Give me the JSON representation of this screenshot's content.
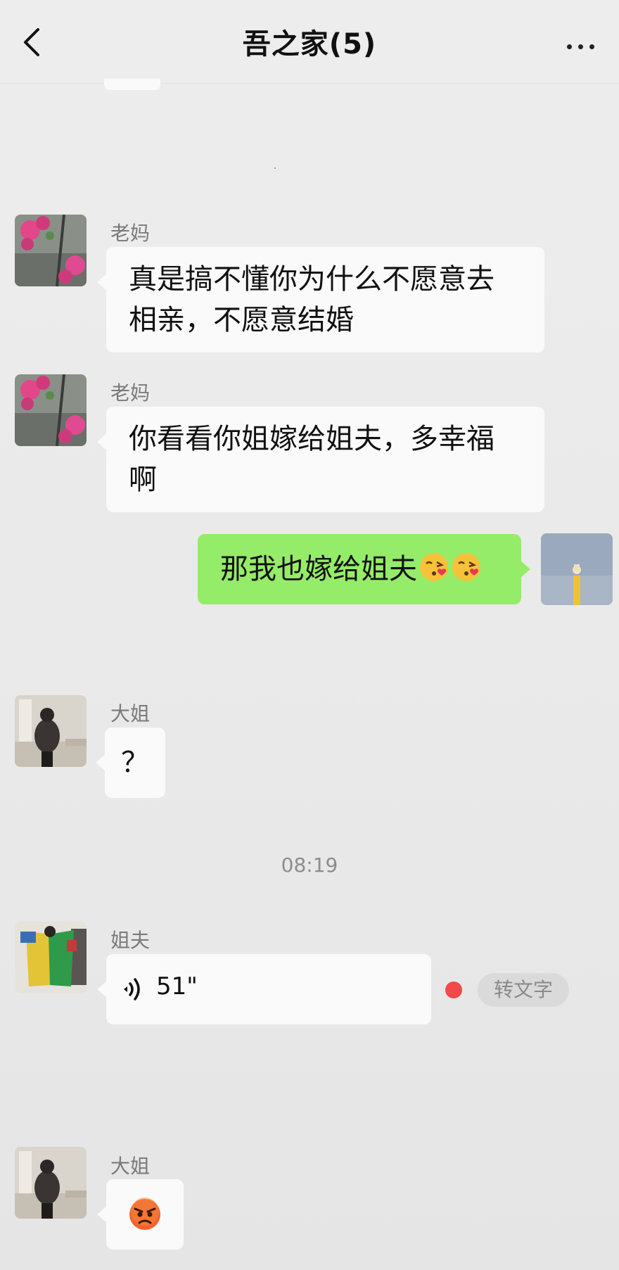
{
  "header": {
    "title": "吾之家(5)"
  },
  "messages": [
    {
      "sender": "老妈",
      "text_line1": "真是搞不懂你为什么不愿意去",
      "text_line2": "相亲，不愿意结婚"
    },
    {
      "sender": "老妈",
      "text_line1": "你看看你姐嫁给姐夫，多幸福",
      "text_line2": "啊"
    },
    {
      "sender": "self",
      "text": "那我也嫁给姐夫",
      "emoji": [
        "kissing-heart-emoji",
        "kissing-heart-emoji"
      ]
    },
    {
      "sender": "大姐",
      "text": "？"
    },
    {
      "timestamp": "08:19"
    },
    {
      "sender": "姐夫",
      "voice_duration": "51\"",
      "unread": true,
      "to_text_label": "转文字"
    },
    {
      "sender": "大姐",
      "emoji": "angry-face-emoji"
    }
  ],
  "colors": {
    "background": "#ededed",
    "bubble_received": "#fafafa",
    "bubble_sent": "#95ec69",
    "unread_dot": "#f04a4a"
  }
}
